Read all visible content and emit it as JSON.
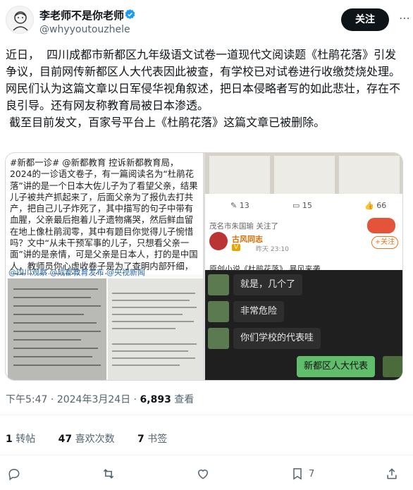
{
  "author": {
    "name": "李老师不是你老师",
    "handle": "@whyyoutouzhele",
    "verified_icon": "verified-badge-icon",
    "follow_label": "关注"
  },
  "tweet": {
    "paragraphs": [
      "近日，  四川成都市新都区九年级语文试卷一道现代文阅读题《杜鹃花落》引发争议，目前网传新都区人大代表因此被查，有学校已对试卷进行收缴焚烧处理。",
      "网民们认为这篇文章以日军侵华视角叙述，把日本侵略者写的如此悲壮，存在不良引导。还有网友称教育局被日本渗透。",
      " 截至目前发文，百家号平台上《杜鹃花落》这篇文章已被删除。"
    ]
  },
  "media": {
    "left_text": "#新都一诊# @新都教育 控诉新都教育局，2024的一诊语文卷子，有一篇阅读名为“杜鹃花落”讲的是一个日本大佐儿子为了看望父亲，结果儿子被共产抓起来了，后面父亲为了报仇去打共产，把自己儿子炸死了，其中描写的句子中带有血腥，父亲最后抱着儿子遗物痛哭，然后鲜血留在地上像杜鹃润零，其中有题目你觉得儿子惋惜吗？文中“从未干预军事的儿子，只想看父亲一面”讲的是亲情，可是父亲是日本人，打的是中国人，教师员你心虚收卷子是为了查明内部歼细，还是为了销毁证据？!出这",
    "left_tags": "@四川观察 @成都教育发布 @央视新闻",
    "stats": {
      "comments": "13",
      "reposts": "15",
      "likes": "66"
    },
    "post": {
      "location": "茂名市朱国瑜 关注了",
      "author": "古风同志",
      "badge": "V",
      "time": "昨天 23:10",
      "follow": "+关注",
      "title": "原创小说《杜鹃花落》   暴风来袭"
    },
    "chat": [
      {
        "text": "就是，几个了",
        "side": "left"
      },
      {
        "text": "非常危险",
        "side": "left"
      },
      {
        "text": "你们学校的代表哇",
        "side": "left"
      },
      {
        "text": "新都区人大代表",
        "side": "right"
      }
    ]
  },
  "meta": {
    "time": "下午5:47",
    "date": "2024年3月24日",
    "views_count": "6,893",
    "views_label": "查看"
  },
  "stats": {
    "reposts_count": "1",
    "reposts_label": "转帖",
    "quotes_count": "47",
    "quotes_label": "喜欢次数",
    "bookmarks_count": "7",
    "bookmarks_label": "书签"
  },
  "actions": {
    "bookmark_count": "7"
  }
}
